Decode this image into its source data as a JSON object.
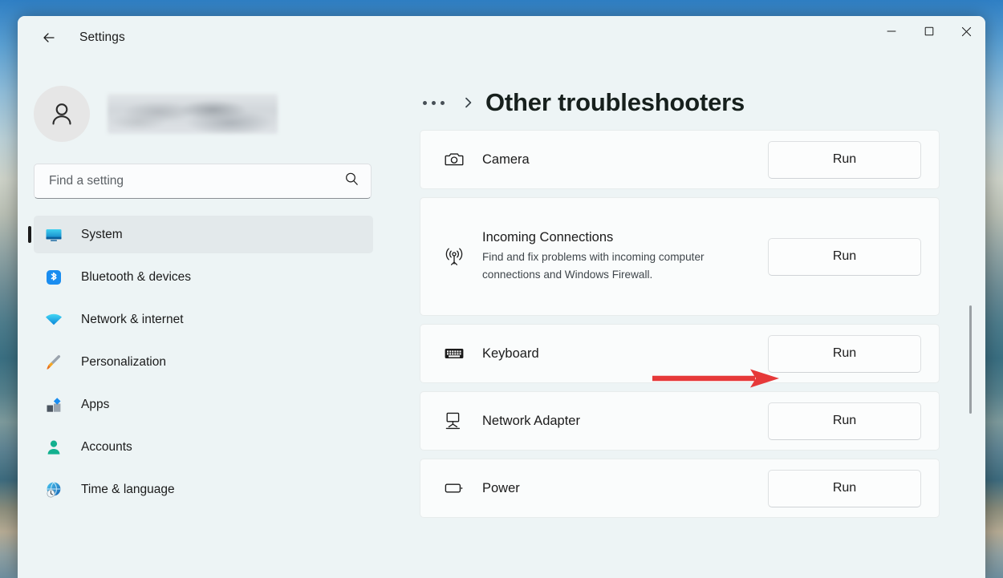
{
  "window": {
    "app_title": "Settings",
    "back_icon": "back-arrow-icon",
    "controls": {
      "minimize": "minimize-icon",
      "maximize": "maximize-icon",
      "close": "close-icon"
    }
  },
  "sidebar": {
    "profile": {
      "avatar_icon": "person-avatar-icon",
      "name": ""
    },
    "search": {
      "placeholder": "Find a setting",
      "value": "",
      "icon": "search-icon"
    },
    "items": [
      {
        "label": "System",
        "icon": "monitor-icon",
        "selected": true
      },
      {
        "label": "Bluetooth & devices",
        "icon": "bluetooth-icon",
        "selected": false
      },
      {
        "label": "Network & internet",
        "icon": "wifi-icon",
        "selected": false
      },
      {
        "label": "Personalization",
        "icon": "paintbrush-icon",
        "selected": false
      },
      {
        "label": "Apps",
        "icon": "apps-icon",
        "selected": false
      },
      {
        "label": "Accounts",
        "icon": "accounts-person-icon",
        "selected": false
      },
      {
        "label": "Time & language",
        "icon": "globe-clock-icon",
        "selected": false
      }
    ]
  },
  "main": {
    "breadcrumb": {
      "ellipsis": "more-breadcrumb-icon",
      "chevron": "chevron-right-icon"
    },
    "page_title": "Other troubleshooters",
    "troubleshooters": [
      {
        "name": "Camera",
        "description": "",
        "icon": "camera-icon",
        "action_label": "Run"
      },
      {
        "name": "Incoming Connections",
        "description": "Find and fix problems with incoming computer connections and Windows Firewall.",
        "icon": "broadcast-icon",
        "action_label": "Run"
      },
      {
        "name": "Keyboard",
        "description": "",
        "icon": "keyboard-icon",
        "action_label": "Run"
      },
      {
        "name": "Network Adapter",
        "description": "",
        "icon": "network-adapter-icon",
        "action_label": "Run"
      },
      {
        "name": "Power",
        "description": "",
        "icon": "battery-icon",
        "action_label": "Run"
      }
    ],
    "scrollbar": "vertical-scrollbar"
  },
  "annotation": {
    "type": "arrow",
    "color": "#e63939",
    "points_to": "Keyboard Run button"
  },
  "colors": {
    "window_background": "#edf4f5",
    "card_background": "#fafcfc",
    "selected_nav": "#e3e9eb",
    "text_primary": "#1b1b1b",
    "annotation_red": "#e63939"
  }
}
